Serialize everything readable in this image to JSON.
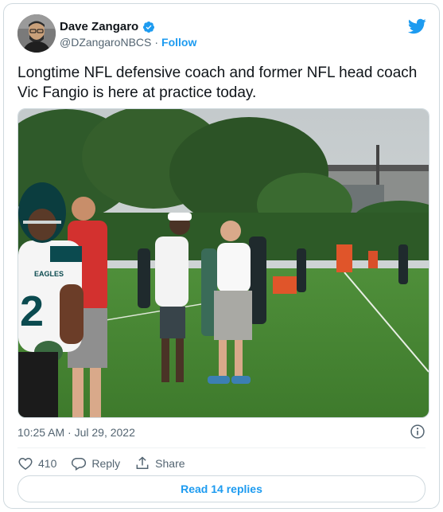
{
  "author": {
    "name": "Dave Zangaro",
    "handle": "@DZangaroNBCS",
    "separator": "·",
    "follow_label": "Follow",
    "verified": true
  },
  "tweet": {
    "text": "Longtime NFL defensive coach and former NFL head coach Vic Fangio is here at practice today.",
    "timestamp": "10:25 AM · Jul 29, 2022"
  },
  "photo": {
    "jersey_number": "2",
    "jersey_text": "EAGLES"
  },
  "actions": {
    "likes_count": "410",
    "reply_label": "Reply",
    "share_label": "Share",
    "read_replies_label": "Read 14 replies"
  },
  "colors": {
    "accent": "#1d9bf0",
    "text": "#0f1419",
    "muted": "#536471",
    "border": "#cfd9de"
  },
  "icons": [
    "verified-badge-icon",
    "twitter-bird-icon",
    "info-icon",
    "heart-icon",
    "reply-bubble-icon",
    "share-icon"
  ]
}
